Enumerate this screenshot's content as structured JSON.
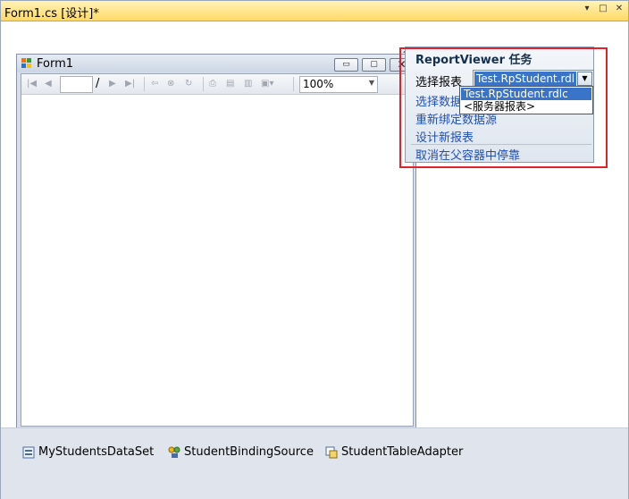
{
  "document_tab": {
    "title": "Form1.cs [设计]*",
    "controls": [
      "▾",
      "□",
      "✕"
    ]
  },
  "form": {
    "title": "Form1",
    "buttons": {
      "minimize": "▭",
      "maximize": "▢",
      "close": "✕"
    }
  },
  "report_toolbar": {
    "page_separator": "/",
    "zoom": "100%"
  },
  "smart_tag": {
    "title": "ReportViewer 任务",
    "choose_report_label": "选择报表",
    "selected_report": "Test.RpStudent.rdl",
    "links": [
      "选择数据源",
      "重新绑定数据源",
      "设计新报表",
      "取消在父容器中停靠"
    ]
  },
  "report_dropdown": {
    "options": [
      "Test.RpStudent.rdlc",
      "<服务器报表>"
    ],
    "selected_index": 0
  },
  "component_tray": {
    "items": [
      "MyStudentsDataSet",
      "StudentBindingSource",
      "StudentTableAdapter"
    ]
  },
  "colors": {
    "accent_selection": "#3a74c9",
    "highlight_outline": "#e0232b",
    "link": "#1f4fb8",
    "tab_bar": "#ffd966"
  }
}
